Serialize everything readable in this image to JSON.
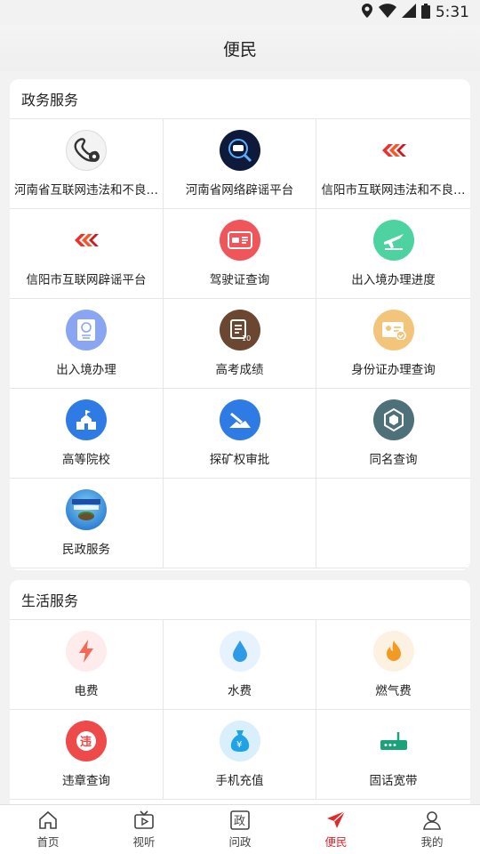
{
  "status_bar": {
    "time": "5:31"
  },
  "header": {
    "title": "便民"
  },
  "gov_section": {
    "title": "政务服务",
    "items": [
      {
        "label": "河南省互联网违法和不良…",
        "icon": "phone-gear-icon"
      },
      {
        "label": "河南省网络辟谣平台",
        "icon": "rumor-search-icon"
      },
      {
        "label": "信阳市互联网违法和不良…",
        "icon": "red-arrows-icon"
      },
      {
        "label": "信阳市互联网辟谣平台",
        "icon": "red-arrows-icon"
      },
      {
        "label": "驾驶证查询",
        "icon": "driver-license-icon"
      },
      {
        "label": "出入境办理进度",
        "icon": "airplane-icon"
      },
      {
        "label": "出入境办理",
        "icon": "passport-icon"
      },
      {
        "label": "高考成绩",
        "icon": "exam-score-icon"
      },
      {
        "label": "身份证办理查询",
        "icon": "id-card-icon"
      },
      {
        "label": "高等院校",
        "icon": "school-icon"
      },
      {
        "label": "探矿权审批",
        "icon": "mining-icon"
      },
      {
        "label": "同名查询",
        "icon": "hexagon-icon"
      },
      {
        "label": "民政服务",
        "icon": "civil-affairs-icon"
      }
    ]
  },
  "life_section": {
    "title": "生活服务",
    "items": [
      {
        "label": "电费",
        "icon": "lightning-icon"
      },
      {
        "label": "水费",
        "icon": "water-drop-icon"
      },
      {
        "label": "燃气费",
        "icon": "flame-icon"
      },
      {
        "label": "违章查询",
        "icon": "violation-icon"
      },
      {
        "label": "手机充值",
        "icon": "money-bag-icon"
      },
      {
        "label": "固话宽带",
        "icon": "router-icon"
      }
    ]
  },
  "tabbar": {
    "tabs": [
      {
        "label": "首页",
        "icon": "home-icon"
      },
      {
        "label": "视听",
        "icon": "tv-icon"
      },
      {
        "label": "问政",
        "icon": "question-gov-icon",
        "glyph": "政"
      },
      {
        "label": "便民",
        "icon": "paper-plane-icon",
        "active": true
      },
      {
        "label": "我的",
        "icon": "person-icon"
      }
    ]
  },
  "colors": {
    "accent": "#e0292b"
  }
}
